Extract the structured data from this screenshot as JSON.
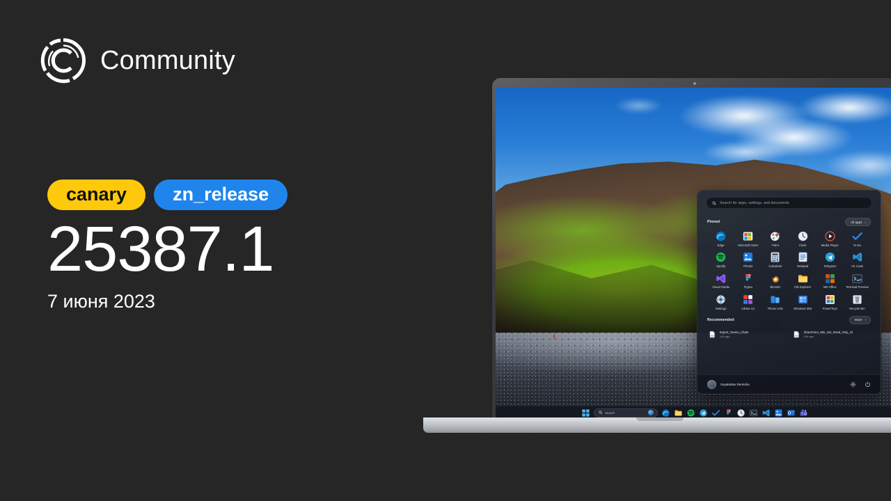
{
  "brand": {
    "name": "Community",
    "logo_icon": "community-circle-logo"
  },
  "release": {
    "channel_badge": "canary",
    "branch_badge": "zn_release",
    "build_number": "25387.1",
    "date": "7 июня 2023",
    "colors": {
      "canary": "#FFC90B",
      "branch": "#1f85ec",
      "background": "#262626"
    }
  },
  "start_menu": {
    "search_placeholder": "Search for apps, settings, and documents",
    "search_icon": "search-icon",
    "pinned": {
      "title": "Pinned",
      "all_apps_label": "All apps",
      "chevron": "›",
      "apps": [
        {
          "label": "Edge",
          "icon": "edge-icon"
        },
        {
          "label": "Microsoft Store",
          "icon": "microsoft-store-icon"
        },
        {
          "label": "Paint",
          "icon": "paint-icon"
        },
        {
          "label": "Clock",
          "icon": "clock-icon"
        },
        {
          "label": "Media Player",
          "icon": "media-player-icon"
        },
        {
          "label": "To Do",
          "icon": "to-do-icon"
        },
        {
          "label": "Spotify",
          "icon": "spotify-icon"
        },
        {
          "label": "Photos",
          "icon": "photos-icon"
        },
        {
          "label": "Calculator",
          "icon": "calculator-icon"
        },
        {
          "label": "Notepad",
          "icon": "notepad-icon"
        },
        {
          "label": "Telegram",
          "icon": "telegram-icon"
        },
        {
          "label": "VS Code",
          "icon": "vs-code-icon"
        },
        {
          "label": "Visual Studio",
          "icon": "visual-studio-icon"
        },
        {
          "label": "Figma",
          "icon": "figma-icon"
        },
        {
          "label": "Blender",
          "icon": "blender-icon"
        },
        {
          "label": "File Explorer",
          "icon": "file-explorer-icon"
        },
        {
          "label": "MS Office",
          "icon": "ms-office-icon"
        },
        {
          "label": "Terminal Preview",
          "icon": "terminal-preview-icon"
        },
        {
          "label": "Settings",
          "icon": "settings-icon"
        },
        {
          "label": "Adobe CC",
          "icon": "adobe-cc-icon"
        },
        {
          "label": "Phone Link",
          "icon": "phone-link-icon"
        },
        {
          "label": "Windows 365",
          "icon": "windows-365-icon"
        },
        {
          "label": "PowerToys",
          "icon": "powertoys-icon"
        },
        {
          "label": "Recycle Bin",
          "icon": "recycle-bin-icon"
        }
      ]
    },
    "recommended": {
      "title": "Recommended",
      "more_label": "More",
      "chevron": "›",
      "items": [
        {
          "name": "Export_Teams_Chats",
          "time": "14h ago",
          "icon": "document-icon"
        },
        {
          "name": "SharePoint_Site_Set_Read_Only_All",
          "time": "10h ago",
          "icon": "document-icon"
        }
      ]
    },
    "footer": {
      "user_name": "Svyatoslav Demidov",
      "avatar_icon": "avatar",
      "settings_icon": "gear-icon",
      "power_icon": "power-icon"
    }
  },
  "taskbar": {
    "start_icon": "windows-start-icon",
    "search_placeholder": "Search",
    "search_icon": "search-icon",
    "copilot_icon": "copilot-orb-icon",
    "apps": [
      {
        "icon": "edge-icon"
      },
      {
        "icon": "file-explorer-icon"
      },
      {
        "icon": "spotify-icon"
      },
      {
        "icon": "telegram-icon"
      },
      {
        "icon": "to-do-icon"
      },
      {
        "icon": "figma-icon"
      },
      {
        "icon": "clock-icon"
      },
      {
        "icon": "terminal-icon"
      },
      {
        "icon": "vs-code-icon"
      },
      {
        "icon": "photos-icon"
      },
      {
        "icon": "outlook-icon"
      },
      {
        "icon": "teams-icon"
      }
    ]
  },
  "device": {
    "type": "laptop",
    "webcam_icon": "webcam-dot"
  },
  "wallpaper": {
    "scene": "coastal-cliff-black-sand-beach"
  }
}
